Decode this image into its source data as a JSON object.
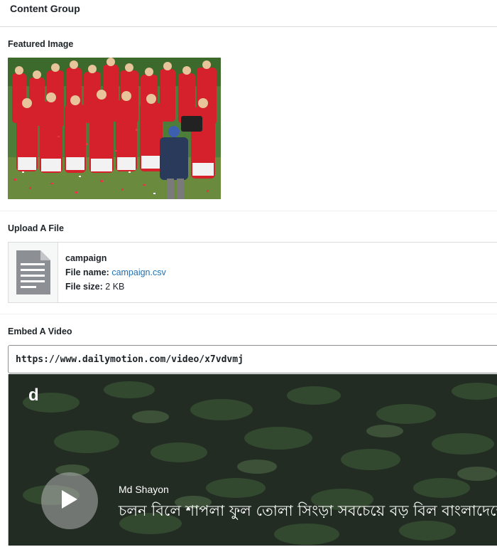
{
  "group": {
    "title": "Content Group"
  },
  "featured_image": {
    "label": "Featured Image"
  },
  "upload": {
    "label": "Upload A File",
    "file_title": "campaign",
    "file_name_label": "File name:",
    "file_name": "campaign.csv",
    "file_size_label": "File size:",
    "file_size": "2 KB"
  },
  "embed": {
    "label": "Embed A Video",
    "url": "https://www.dailymotion.com/video/x7vdvmj",
    "player": {
      "logo": "d",
      "channel": "Md Shayon",
      "title": "চলন বিলে শাপলা ফুল তোলা সিংড়া সবচেয়ে বড় বিল বাংলাদেশে"
    }
  },
  "icons": {
    "file": "document-icon",
    "play": "play-icon"
  }
}
